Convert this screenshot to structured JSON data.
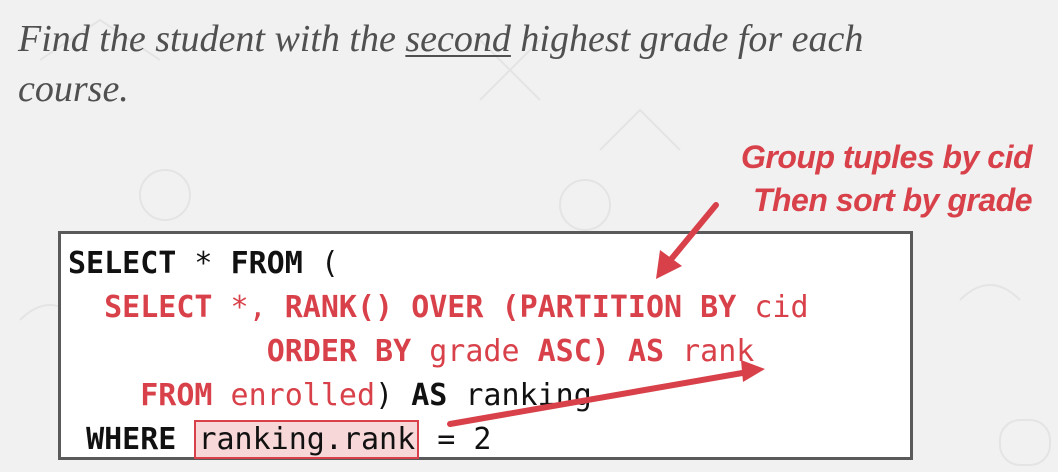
{
  "heading": {
    "before": "Find the student with the ",
    "emphasis": "second",
    "after": " highest grade for each course."
  },
  "callout": {
    "line1": "Group tuples by cid",
    "line2": "Then sort by grade"
  },
  "code": {
    "l1_kw1": "SELECT",
    "l1_star": " * ",
    "l1_kw2": "FROM",
    "l1_paren": " (",
    "l2_indent": "  ",
    "l2_kw1": "SELECT",
    "l2_star": " *, ",
    "l2_kw2": "RANK()",
    "l2_sp": " ",
    "l2_kw3": "OVER",
    "l2_paren": " (",
    "l2_kw4": "PARTITION BY",
    "l2_col": " cid",
    "l3_indent": "           ",
    "l3_kw1": "ORDER BY",
    "l3_col": " grade ",
    "l3_kw2": "ASC)",
    "l3_sp": " ",
    "l3_kw3": "AS",
    "l3_alias": " rank",
    "l4_indent": "    ",
    "l4_kw1": "FROM",
    "l4_table": " enrolled",
    "l4_paren": ") ",
    "l4_kw2": "AS",
    "l4_alias": " ranking",
    "l5_indent": " ",
    "l5_kw1": "WHERE",
    "l5_sp": " ",
    "l5_highlight": "ranking.rank",
    "l5_rest": " = 2"
  },
  "colors": {
    "accent": "#d9414a",
    "text": "#505050",
    "highlight_bg": "#f7d7d7"
  }
}
